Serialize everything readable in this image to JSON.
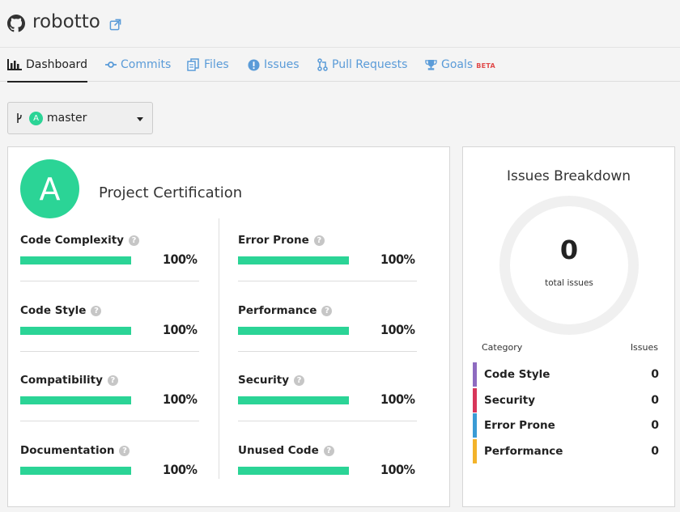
{
  "header": {
    "repo_name": "robotto"
  },
  "nav": {
    "tabs": [
      {
        "label": "Dashboard",
        "icon": "bar-chart-icon",
        "active": true
      },
      {
        "label": "Commits",
        "icon": "commit-icon"
      },
      {
        "label": "Files",
        "icon": "files-icon"
      },
      {
        "label": "Issues",
        "icon": "exclamation-circle-icon"
      },
      {
        "label": "Pull Requests",
        "icon": "pull-request-icon"
      },
      {
        "label": "Goals",
        "icon": "trophy-icon",
        "badge": "BETA"
      }
    ]
  },
  "branch": {
    "grade": "A",
    "name": "master"
  },
  "certification": {
    "grade": "A",
    "title": "Project Certification",
    "metrics": [
      {
        "label": "Code Complexity",
        "value": "100%",
        "fraction": 1.0
      },
      {
        "label": "Error Prone",
        "value": "100%",
        "fraction": 1.0
      },
      {
        "label": "Code Style",
        "value": "100%",
        "fraction": 1.0
      },
      {
        "label": "Performance",
        "value": "100%",
        "fraction": 1.0
      },
      {
        "label": "Compatibility",
        "value": "100%",
        "fraction": 1.0
      },
      {
        "label": "Security",
        "value": "100%",
        "fraction": 1.0
      },
      {
        "label": "Documentation",
        "value": "100%",
        "fraction": 1.0
      },
      {
        "label": "Unused Code",
        "value": "100%",
        "fraction": 1.0
      }
    ]
  },
  "breakdown": {
    "title": "Issues Breakdown",
    "total": "0",
    "total_label": "total issues",
    "col_category": "Category",
    "col_issues": "Issues",
    "rows": [
      {
        "label": "Code Style",
        "value": "0",
        "color": "#8e6bc0"
      },
      {
        "label": "Security",
        "value": "0",
        "color": "#d8365a"
      },
      {
        "label": "Error Prone",
        "value": "0",
        "color": "#3a9bd5"
      },
      {
        "label": "Performance",
        "value": "0",
        "color": "#f3b32a"
      }
    ]
  },
  "colors": {
    "accent": "#2bd496",
    "link": "#5a9bd8"
  }
}
